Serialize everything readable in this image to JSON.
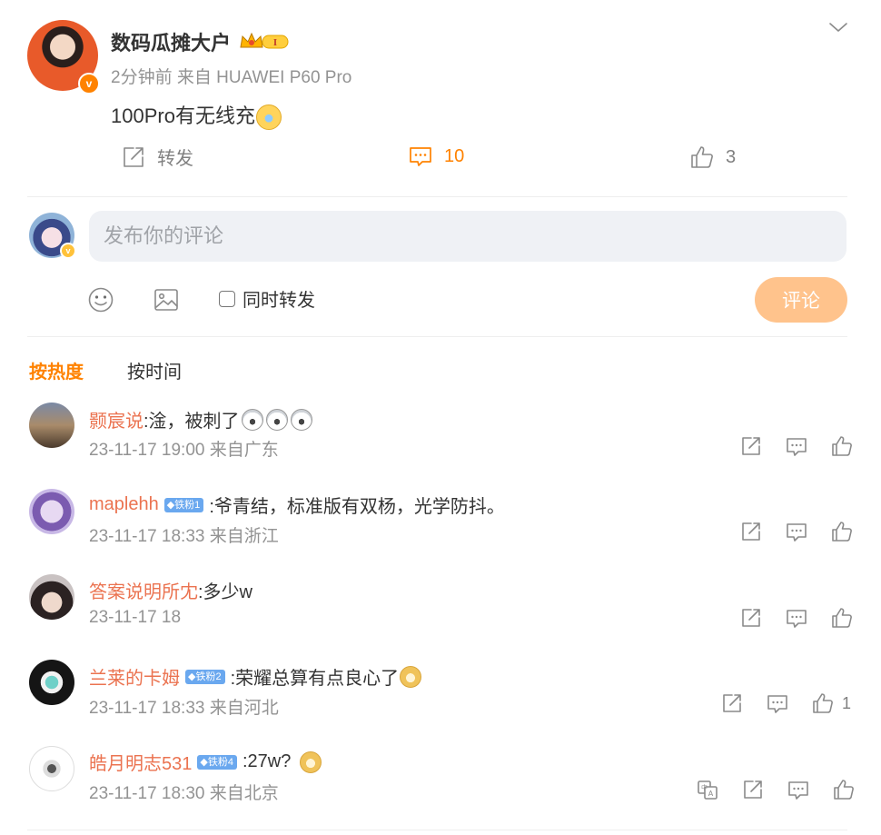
{
  "post": {
    "author": "数码瓜摊大户",
    "crown_badge_label": "I",
    "meta": "2分钟前 来自 HUAWEI P60 Pro",
    "text": "100Pro有无线充",
    "actions": {
      "repost_label": "转发",
      "comment_count": "10",
      "like_count": "3"
    }
  },
  "composer": {
    "placeholder": "发布你的评论",
    "also_repost_label": "同时转发",
    "submit_label": "评论"
  },
  "sort_tabs": {
    "hot": "按热度",
    "time": "按时间"
  },
  "comments": [
    {
      "user": "颢宸说",
      "fan_badge": "",
      "text": ":淦，被刺了",
      "meta": "23-11-17 19:00 来自广东",
      "likes": ""
    },
    {
      "user": "maplehh",
      "fan_badge": "铁粉1",
      "text": ":爷青结，标准版有双杨，光学防抖。",
      "meta": "23-11-17 18:33 来自浙江",
      "likes": ""
    },
    {
      "user": "答案说明所冘",
      "fan_badge": "",
      "text": ":多少w",
      "meta": "23-11-17 18",
      "likes": ""
    },
    {
      "user": "兰莱的卡姆",
      "fan_badge": "铁粉2",
      "text": ":荣耀总算有点良心了",
      "meta": "23-11-17 18:33 来自河北",
      "likes": "1"
    },
    {
      "user": "皓月明志531",
      "fan_badge": "铁粉4",
      "text": ":27w? ",
      "meta": "23-11-17 18:30 来自北京",
      "likes": ""
    }
  ],
  "colors": {
    "accent": "#ff8200",
    "username": "#eb7350",
    "muted": "#939393",
    "submit_disabled": "#ffc38c",
    "fan_badge": "#6aa8ef"
  },
  "icons": [
    "chevron-down-icon",
    "repost-icon",
    "comment-icon",
    "like-icon",
    "emoji-icon",
    "image-icon",
    "translate-icon"
  ]
}
